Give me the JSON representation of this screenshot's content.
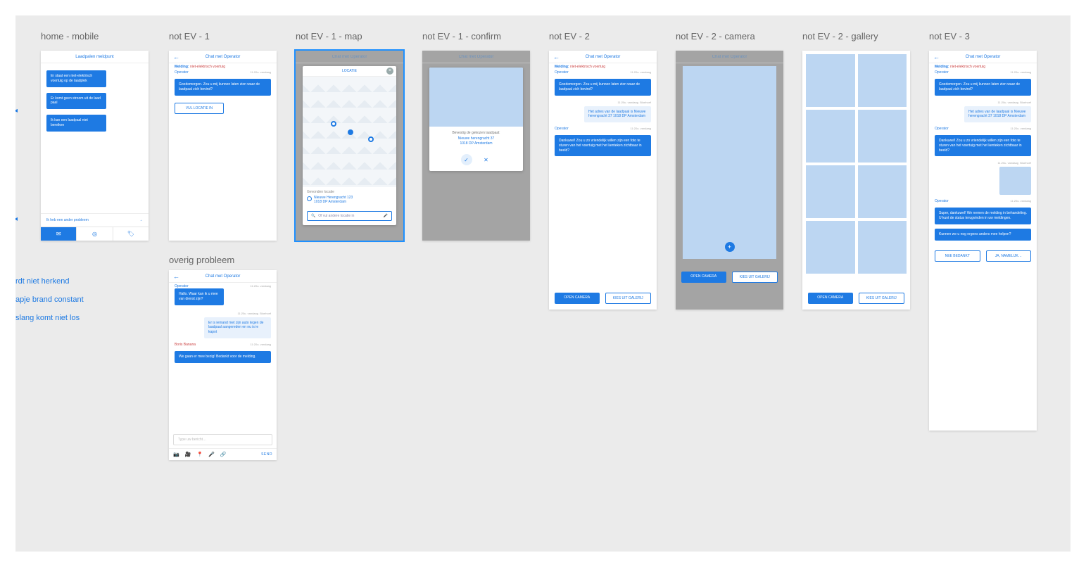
{
  "frame_labels": {
    "home": "home - mobile",
    "nev1": "not  EV - 1",
    "nev1map": "not EV - 1 - map",
    "nev1confirm": "not EV - 1 - confirm",
    "nev2": "not EV - 2",
    "nev2cam": "not EV - 2 - camera",
    "nev2gal": "not EV - 2 - gallery",
    "nev3": "not EV - 3",
    "overig": "overig probleem"
  },
  "common": {
    "chat_title": "Chat met Operator",
    "melding_label": "Melding:",
    "melding_value": "niet-elektrisch voertuig",
    "operator_label": "Operator",
    "timestamp": "11:20u. vandaag",
    "bluehoef": "Bluehoef",
    "open_camera": "OPEN CAMERA",
    "kies_galerij": "KIES UIT GALERIJ"
  },
  "home": {
    "title": "Laadpalen meldpunt",
    "opt1": "Er staat een niet-elektrisch voertuig op de laadplek",
    "opt2": "Er komt geen stroom uit de laad paal",
    "opt3": "Ik kan een laadpaal niet bereiken",
    "other": "Ik heb een ander probleem",
    "arrow": "→"
  },
  "nev1": {
    "greeting": "Goedemorgen. Zou u mij kunnen laten zien waar de laadpaal zich bevind?",
    "btn": "VUL LOCATIE IN"
  },
  "map": {
    "title": "LOCATIE",
    "found_label": "Gevonden locatie",
    "address1": "Nieuwe Herengracht 123",
    "address2": "1018 DP Amsterdam",
    "placeholder": "Of vul andere locatie in"
  },
  "confirm": {
    "question": "Bevestig de gekozen laadpaal:",
    "addr1": "Nieuwe herengracht 37",
    "addr2": "1018 DP Amsterdam",
    "ok": "✓",
    "no": "✕"
  },
  "nev2": {
    "user_addr": "Het adres van de laadpaal is Nieuwe herengracht 37 1018 DP Amsterdam",
    "thanks": "Dankuwel! Zou u zo vriendelijk willen zijn een foto te sturen van het voertuig met het kenteken zichtbaar in beeld?"
  },
  "nev3": {
    "super": "Super, dankuwel! We nemen de melding in behandeling. U kunt de status terugvinden in uw meldingen.",
    "help_more": "Kunnen we u nog ergens anders mee helpen?",
    "no_thanks": "NEE BEDANKT",
    "yes": "JA, NAMELIJK…"
  },
  "overig": {
    "greeting": "Hallo. Waar kan ik u mee van dienst zijn?",
    "user_msg": "Er is iemand met zijn auto tegen de laadpaal aangereden en nu is ie kapot",
    "sender2": "Boris Banana",
    "reply": "We gaan er mee bezig! Bedankt voor de melding.",
    "placeholder": "Type uw bericht…",
    "send": "SEND"
  },
  "loose_links": {
    "l1": "rdt niet herkend",
    "l2": "apje brand constant",
    "l3": "slang komt niet los"
  }
}
